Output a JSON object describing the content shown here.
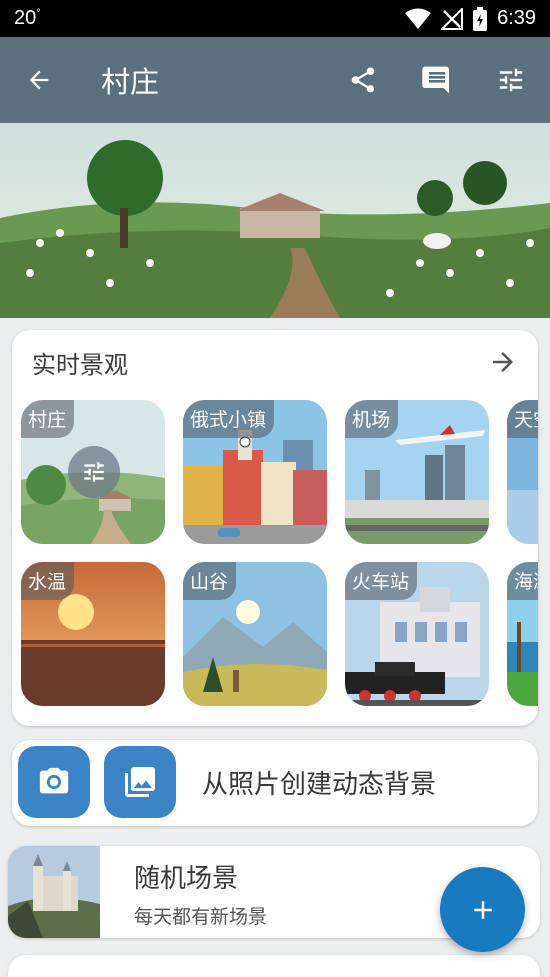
{
  "status": {
    "temperature": "20",
    "temp_unit": "°",
    "time": "6:39"
  },
  "appbar": {
    "title": "村庄",
    "icons": [
      "back-arrow-icon",
      "share-icon",
      "comment-icon",
      "settings-sliders-icon"
    ]
  },
  "live_section": {
    "title": "实时景观",
    "tiles": [
      {
        "label": "村庄",
        "scene": "village"
      },
      {
        "label": "俄式小镇",
        "scene": "russian-town"
      },
      {
        "label": "机场",
        "scene": "airport"
      },
      {
        "label": "天空",
        "scene": "sky"
      },
      {
        "label": "水温",
        "scene": "sunset-sea"
      },
      {
        "label": "山谷",
        "scene": "valley"
      },
      {
        "label": "火车站",
        "scene": "train-station"
      },
      {
        "label": "海滩",
        "scene": "beach"
      }
    ]
  },
  "photo_card": {
    "label": "从照片创建动态背景",
    "icons": [
      "camera-icon",
      "gallery-icon"
    ]
  },
  "random_card": {
    "title": "随机场景",
    "subtitle": "每天都有新场景"
  },
  "colors": {
    "appbar": "#5b6f7d",
    "accent": "#3d84c6",
    "fab": "#1a7ac0"
  }
}
